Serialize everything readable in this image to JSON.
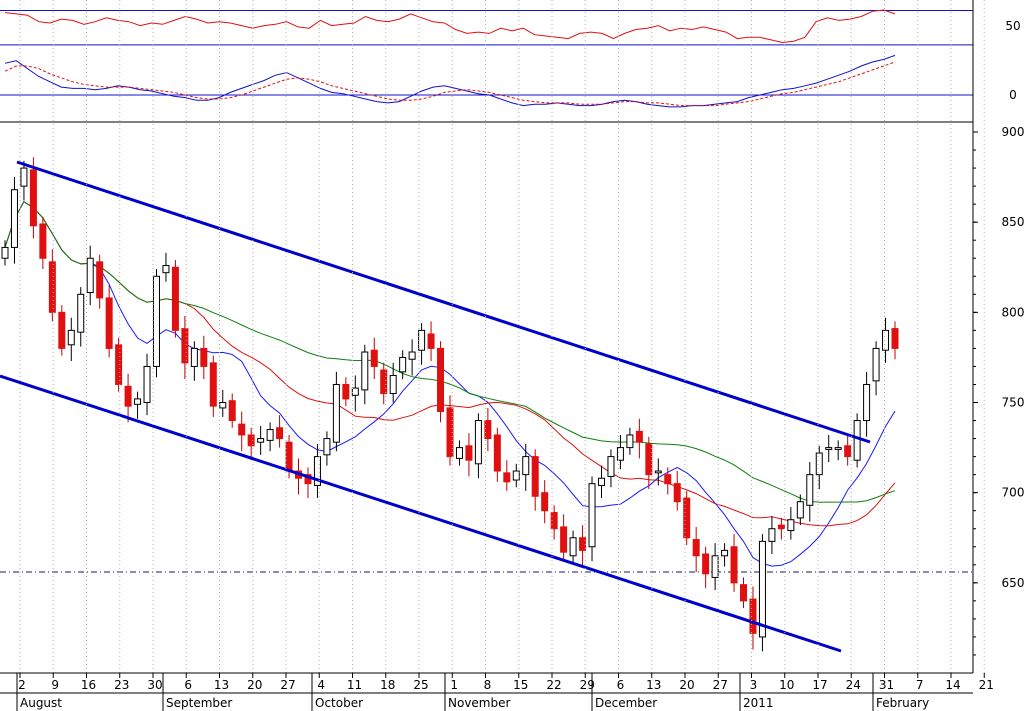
{
  "chart_data": [
    {
      "panel": "top-oscillator",
      "type": "line",
      "y_tick_labels": [
        "50",
        "0"
      ],
      "reference_levels": [
        60,
        40,
        0
      ],
      "series": [
        {
          "values": [
            62,
            61,
            60,
            55,
            54,
            57,
            56,
            53,
            55,
            58,
            56,
            55,
            52,
            54,
            53,
            56,
            59,
            57,
            54,
            55,
            54,
            52,
            50,
            52,
            53,
            55,
            51,
            50,
            56,
            52,
            53,
            54,
            59,
            56,
            55,
            57,
            61,
            58,
            55,
            54,
            49,
            46,
            47,
            46,
            50,
            48,
            50,
            45,
            44,
            43,
            42,
            46,
            47,
            46,
            42,
            46,
            49,
            50,
            52,
            48,
            50,
            49,
            51,
            49,
            47,
            42,
            43,
            43,
            41,
            39,
            40,
            43,
            55,
            58,
            56,
            57,
            59,
            63,
            64,
            61
          ]
        },
        {
          "values": [
            24,
            26,
            20,
            14,
            10,
            6,
            5,
            5,
            4,
            5,
            7,
            6,
            4,
            3,
            1,
            -1,
            -2,
            -4,
            -4,
            -2,
            2,
            5,
            8,
            11,
            15,
            17,
            13,
            9,
            5,
            2,
            1,
            -1,
            -3,
            -5,
            -6,
            -5,
            -1,
            3,
            6,
            7,
            5,
            3,
            1,
            0,
            -3,
            -6,
            -8,
            -7,
            -7,
            -6,
            -7,
            -8,
            -8,
            -7,
            -5,
            -4,
            -5,
            -7,
            -8,
            -9,
            -9,
            -8,
            -8,
            -7,
            -6,
            -5,
            -2,
            0,
            2,
            4,
            5,
            7,
            9,
            12,
            15,
            18,
            22,
            25,
            27,
            30
          ]
        },
        {
          "values": [
            18,
            22,
            22,
            20,
            16,
            13,
            10,
            8,
            7,
            6,
            6,
            6,
            5,
            4,
            3,
            2,
            0,
            -2,
            -3,
            -3,
            -2,
            0,
            3,
            6,
            9,
            12,
            13,
            12,
            10,
            7,
            5,
            3,
            1,
            -1,
            -3,
            -4,
            -4,
            -3,
            -1,
            2,
            3,
            4,
            3,
            2,
            0,
            -2,
            -4,
            -5,
            -6,
            -6,
            -6,
            -7,
            -7,
            -7,
            -6,
            -5,
            -5,
            -6,
            -6,
            -7,
            -8,
            -8,
            -8,
            -8,
            -7,
            -6,
            -5,
            -3,
            -1,
            1,
            2,
            4,
            6,
            8,
            10,
            13,
            16,
            19,
            22,
            25
          ]
        }
      ]
    },
    {
      "panel": "price",
      "type": "candlestick",
      "ylim": [
        600,
        905
      ],
      "y_tick_labels": [
        "900",
        "850",
        "800",
        "750",
        "700",
        "650"
      ],
      "x_tick_labels": [
        "2",
        "9",
        "16",
        "23",
        "30",
        "6",
        "13",
        "20",
        "27",
        "4",
        "11",
        "18",
        "25",
        "1",
        "8",
        "15",
        "22",
        "29",
        "6",
        "13",
        "20",
        "27",
        "3",
        "10",
        "17",
        "24",
        "31",
        "7",
        "14",
        "21"
      ],
      "month_labels": [
        "August",
        "September",
        "October",
        "November",
        "December",
        "2011",
        "February"
      ],
      "horizontal_level": 656,
      "close": [
        836,
        868,
        880,
        848,
        830,
        800,
        780,
        790,
        810,
        830,
        808,
        780,
        760,
        748,
        752,
        770,
        820,
        826,
        790,
        772,
        780,
        770,
        748,
        750,
        740,
        732,
        726,
        730,
        735,
        730,
        712,
        708,
        705,
        720,
        730,
        760,
        752,
        758,
        778,
        770,
        755,
        765,
        775,
        778,
        790,
        780,
        745,
        720,
        725,
        718,
        740,
        730,
        712,
        706,
        712,
        720,
        698,
        690,
        680,
        667,
        675,
        668,
        705,
        708,
        720,
        725,
        732,
        728,
        710,
        712,
        705,
        695,
        675,
        665,
        655,
        665,
        668,
        650,
        640,
        622,
        673,
        680,
        680,
        685,
        695,
        710,
        722,
        725,
        725,
        720,
        740,
        760,
        780,
        790,
        780
      ]
    }
  ]
}
